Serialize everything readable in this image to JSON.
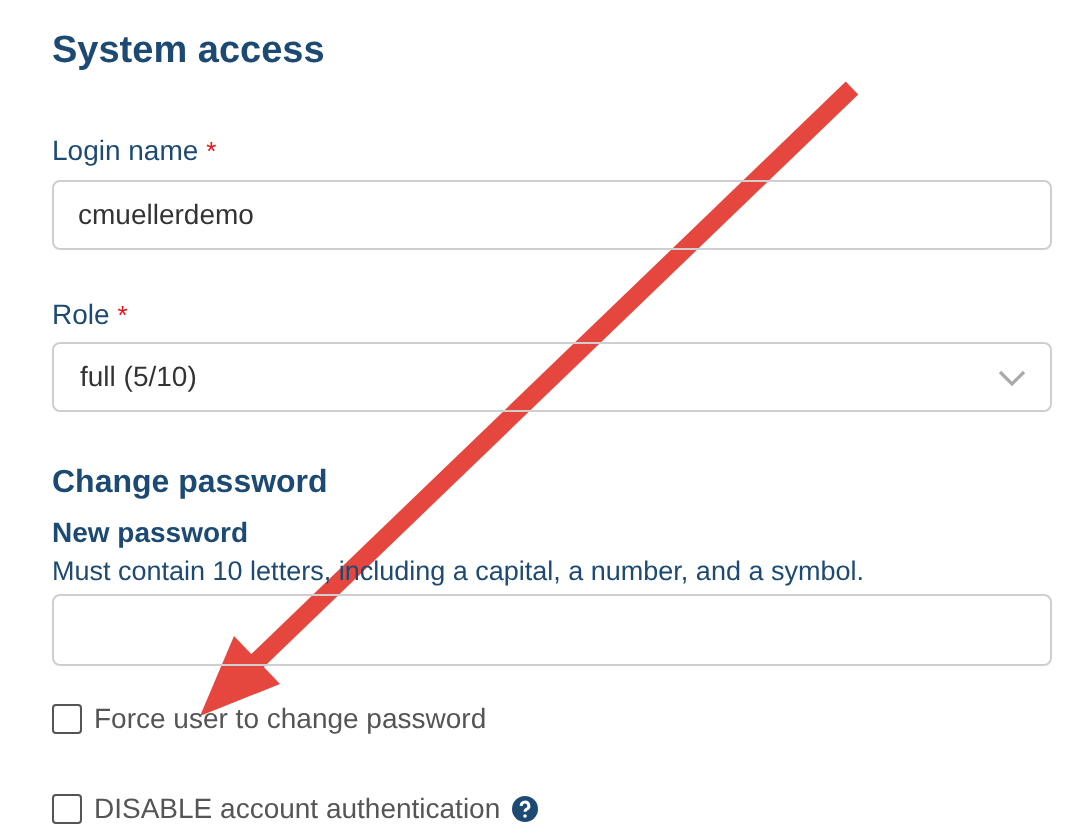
{
  "section_title": "System access",
  "login_name": {
    "label": "Login name",
    "required_mark": "*",
    "value": "cmuellerdemo"
  },
  "role": {
    "label": "Role",
    "required_mark": "*",
    "value": "full (5/10)"
  },
  "change_password": {
    "title": "Change password",
    "label": "New password",
    "hint": "Must contain 10 letters, including a capital, a number, and a symbol."
  },
  "options": [
    {
      "label": "Force user to change password",
      "checked": false,
      "help": false
    },
    {
      "label": "DISABLE account authentication",
      "checked": false,
      "help": true
    }
  ]
}
